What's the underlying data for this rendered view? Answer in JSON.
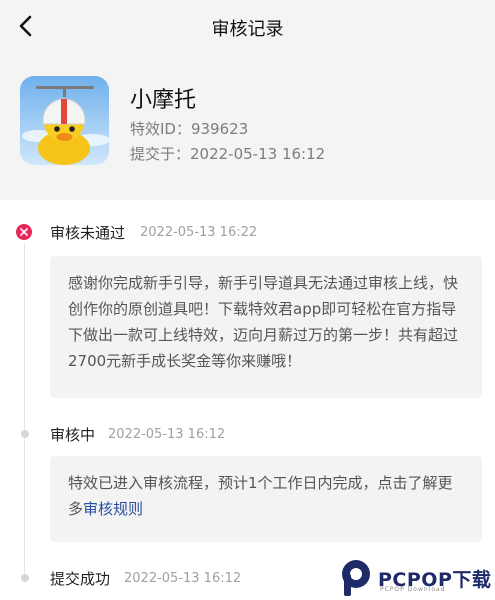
{
  "nav": {
    "title": "审核记录"
  },
  "effect": {
    "name": "小摩托",
    "id_line": "特效ID：939623",
    "submit_line": "提交于：2022-05-13 16:12"
  },
  "timeline": [
    {
      "status": "审核未通过",
      "time": "2022-05-13 16:22",
      "message": "感谢你完成新手引导，新手引导道具无法通过审核上线，快创作你的原创道具吧！下载特效君app即可轻松在官方指导下做出一款可上线特效，迈向月薪过万的第一步！共有超过2700元新手成长奖金等你来赚哦！"
    },
    {
      "status": "审核中",
      "time": "2022-05-13 16:12",
      "message": "特效已进入审核流程，预计1个工作日内完成，点击了解更多",
      "link": "审核规则"
    },
    {
      "status": "提交成功",
      "time": "2022-05-13 16:12"
    }
  ],
  "watermark": {
    "brand": "PCPOP下载",
    "sub": "PCPOP Download"
  },
  "colors": {
    "fail": "#e8265a",
    "link": "#2b4f9b",
    "header_bg": "#f4f4f4"
  }
}
